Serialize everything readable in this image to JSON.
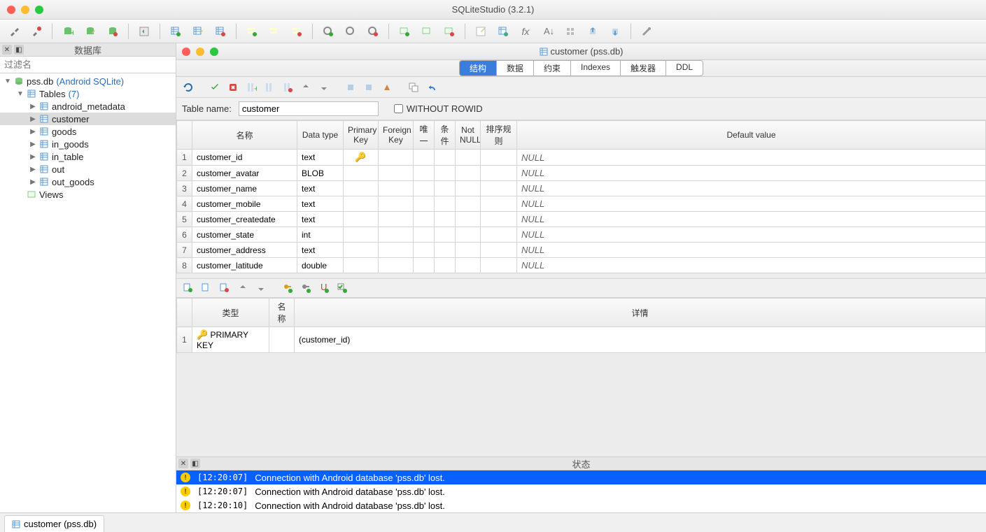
{
  "window": {
    "title": "SQLiteStudio (3.2.1)"
  },
  "sidebar": {
    "header": "数据库",
    "filter_placeholder": "过滤名",
    "db_name": "pss.db",
    "db_type": "(Android SQLite)",
    "tables_label": "Tables",
    "tables_count": "(7)",
    "tables": [
      "android_metadata",
      "customer",
      "goods",
      "in_goods",
      "in_table",
      "out",
      "out_goods"
    ],
    "views_label": "Views",
    "selected_table": "customer"
  },
  "editor": {
    "title": "customer (pss.db)",
    "tabs": [
      "结构",
      "数据",
      "约束",
      "Indexes",
      "触发器",
      "DDL"
    ],
    "active_tab": "结构",
    "table_name_label": "Table name:",
    "table_name_value": "customer",
    "without_rowid_label": "WITHOUT ROWID",
    "columns_header": [
      "名称",
      "Data type",
      "Primary Key",
      "Foreign Key",
      "唯一",
      "条件",
      "Not NULL",
      "排序规则",
      "Default value"
    ],
    "columns": [
      {
        "n": "customer_id",
        "t": "text",
        "pk": true,
        "def": "NULL"
      },
      {
        "n": "customer_avatar",
        "t": "BLOB",
        "pk": false,
        "def": "NULL"
      },
      {
        "n": "customer_name",
        "t": "text",
        "pk": false,
        "def": "NULL"
      },
      {
        "n": "customer_mobile",
        "t": "text",
        "pk": false,
        "def": "NULL"
      },
      {
        "n": "customer_createdate",
        "t": "text",
        "pk": false,
        "def": "NULL"
      },
      {
        "n": "customer_state",
        "t": "int",
        "pk": false,
        "def": "NULL"
      },
      {
        "n": "customer_address",
        "t": "text",
        "pk": false,
        "def": "NULL"
      },
      {
        "n": "customer_latitude",
        "t": "double",
        "pk": false,
        "def": "NULL"
      }
    ],
    "constraints_header": [
      "类型",
      "名称",
      "详情"
    ],
    "constraints": [
      {
        "type": "PRIMARY KEY",
        "name": "",
        "detail": "(customer_id)"
      }
    ]
  },
  "status": {
    "header": "状态",
    "items": [
      {
        "time": "[12:20:07]",
        "msg": "Connection with Android database 'pss.db' lost.",
        "sel": true
      },
      {
        "time": "[12:20:07]",
        "msg": "Connection with Android database 'pss.db' lost.",
        "sel": false
      },
      {
        "time": "[12:20:10]",
        "msg": "Connection with Android database 'pss.db' lost.",
        "sel": false
      }
    ]
  },
  "bottom_tab": "customer (pss.db)"
}
